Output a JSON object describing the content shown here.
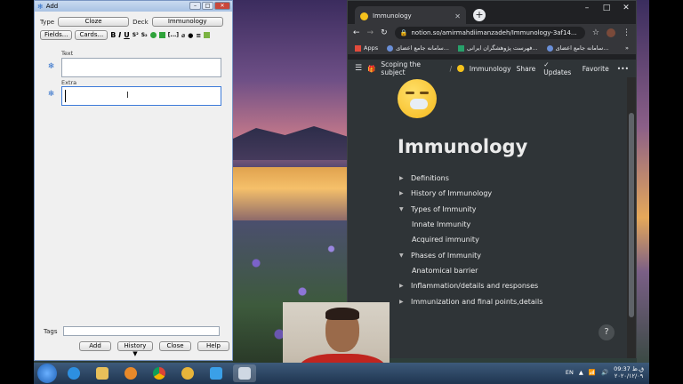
{
  "anki": {
    "window_title": "Add",
    "type_label": "Type",
    "type_value": "Cloze",
    "deck_label": "Deck",
    "deck_value": "Immunology",
    "fields_button": "Fields...",
    "cards_button": "Cards...",
    "format_bold": "B",
    "format_italic": "I",
    "format_underline": "U",
    "format_super": "S²",
    "format_sub": "S₂",
    "format_cloze": "[...]",
    "text_label": "Text",
    "extra_label": "Extra",
    "tags_label": "Tags",
    "add_button": "Add",
    "history_button": "History ▼",
    "close_button": "Close",
    "help_button": "Help"
  },
  "chrome": {
    "tab_title": "Immunology",
    "url": "notion.so/amirmahdiimanzadeh/Immunology-3af14...",
    "bookmarks": [
      "Apps",
      "سامانه جامع اعضای...",
      "فهرست پژوهشگران ایرانی...",
      "سامانه جامع اعضای..."
    ]
  },
  "notion": {
    "breadcrumb_parent": "Scoping the subject",
    "breadcrumb_sep": "/",
    "breadcrumb_current": "Immunology",
    "share": "Share",
    "updates": "Updates",
    "favorite": "Favorite",
    "more": "•••",
    "title": "Immunology",
    "help": "?",
    "toggles": [
      {
        "label": "Definitions",
        "state": "collapsed",
        "child": false
      },
      {
        "label": "History of Immunology",
        "state": "collapsed",
        "child": false
      },
      {
        "label": "Types of Immunity",
        "state": "expanded",
        "child": false
      },
      {
        "label": "Innate Immunity",
        "state": "none",
        "child": true
      },
      {
        "label": "Acquired immunity",
        "state": "none",
        "child": true
      },
      {
        "label": "Phases of Immunity",
        "state": "expanded",
        "child": false
      },
      {
        "label": "Anatomical barrier",
        "state": "none",
        "child": true
      },
      {
        "label": "Inflammation/details and responses",
        "state": "collapsed",
        "child": false
      },
      {
        "label": "Immunization and final points,details",
        "state": "collapsed",
        "child": false
      }
    ]
  },
  "taskbar": {
    "lang": "EN",
    "time": "09:37 ق.ظ",
    "date": "۲۰۲۰/۱۲/۰۹"
  },
  "colors": {
    "notion_bg": "#2f3437",
    "chrome_bg": "#202124",
    "anki_bg": "#f0f0f0"
  }
}
